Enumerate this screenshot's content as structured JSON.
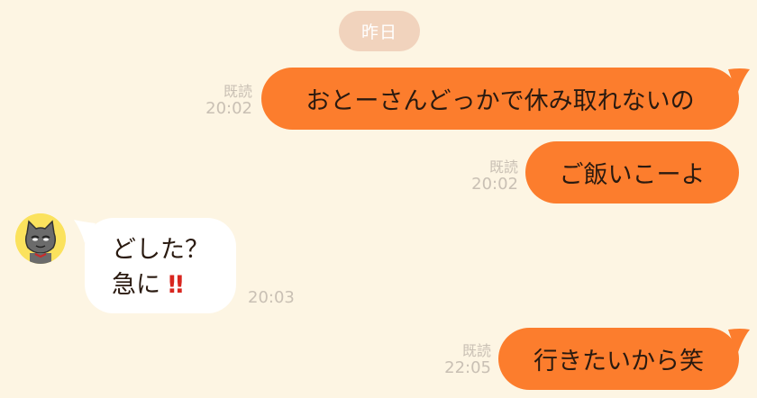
{
  "chat": {
    "date_separator": "昨日",
    "messages": [
      {
        "direction": "outgoing",
        "text": "おとーさんどっかで休み取れないの",
        "read_label": "既読",
        "time": "20:02"
      },
      {
        "direction": "outgoing",
        "text": "ご飯いこーよ",
        "read_label": "既読",
        "time": "20:02"
      },
      {
        "direction": "incoming",
        "avatar_icon": "cat-avatar-icon",
        "line1": "どした？",
        "line2": "急に",
        "emoji": "‼",
        "time": "20:03"
      },
      {
        "direction": "outgoing",
        "text": "行きたいから笑",
        "read_label": "既読",
        "time": "22:05"
      }
    ]
  },
  "colors": {
    "background": "#fdf5e3",
    "outgoing_bubble": "#fc7d2d",
    "incoming_bubble": "#ffffff",
    "date_pill": "#f1d3bd",
    "meta_text": "#c9c0b4",
    "emoji_red": "#d8261f"
  }
}
